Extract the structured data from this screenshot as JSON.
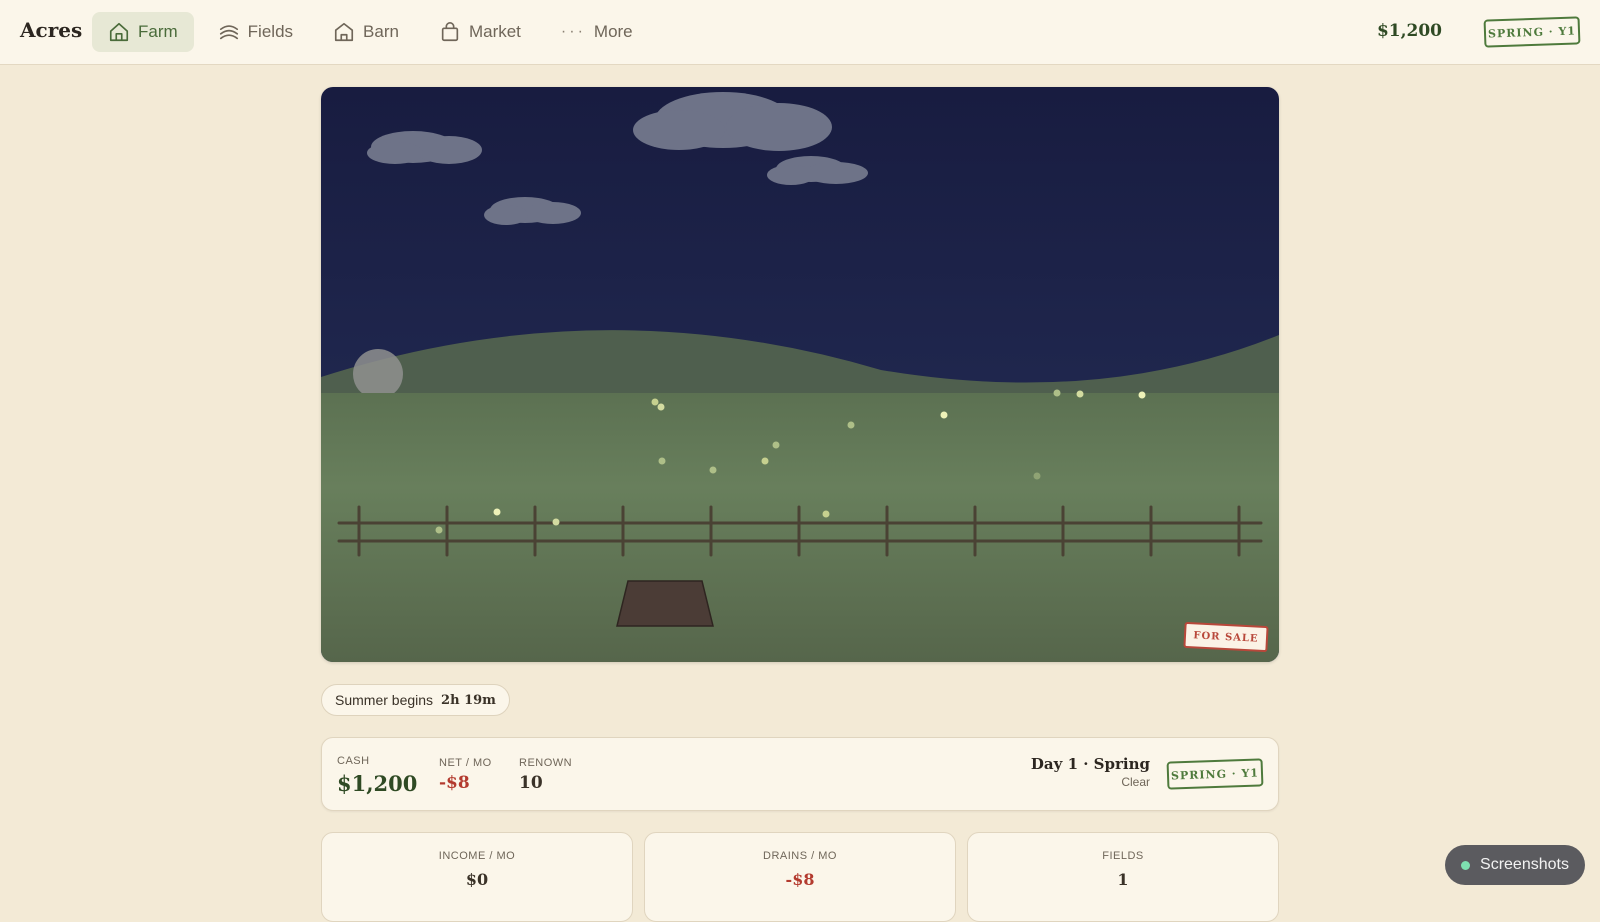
{
  "app": {
    "title": "Acres"
  },
  "nav": {
    "items": [
      {
        "label": "Farm",
        "icon": "home-icon",
        "active": true
      },
      {
        "label": "Fields",
        "icon": "wheat-icon",
        "active": false
      },
      {
        "label": "Barn",
        "icon": "barn-icon",
        "active": false
      },
      {
        "label": "Market",
        "icon": "bag-icon",
        "active": false
      },
      {
        "label": "More",
        "icon": "dots-icon",
        "active": false
      }
    ],
    "more_dots": "···"
  },
  "header": {
    "cash": "$1,200",
    "season_stamp": "SPRING · Y1"
  },
  "scene": {
    "for_sale_sign": "FOR SALE"
  },
  "season_timer": {
    "label": "Summer begins",
    "time": "2h 19m"
  },
  "status": {
    "cash_label": "CASH",
    "cash_value": "$1,200",
    "net_label": "NET / MO",
    "net_value": "-$8",
    "renown_label": "RENOWN",
    "renown_value": "10",
    "day_title": "Day 1 · Spring",
    "weather": "Clear",
    "season_stamp": "SPRING · Y1"
  },
  "cards": {
    "income": {
      "label": "INCOME / MO",
      "value": "$0"
    },
    "drains": {
      "label": "DRAINS / MO",
      "value": "-$8"
    },
    "fields": {
      "label": "FIELDS",
      "value": "1"
    }
  },
  "screenshots_button": {
    "label": "Screenshots"
  },
  "colors": {
    "accent_green": "#4e7a3c",
    "negative_red": "#b33a2e",
    "night_sky": "#1c2246",
    "field_green": "#647a58",
    "background": "#f3ead6"
  }
}
